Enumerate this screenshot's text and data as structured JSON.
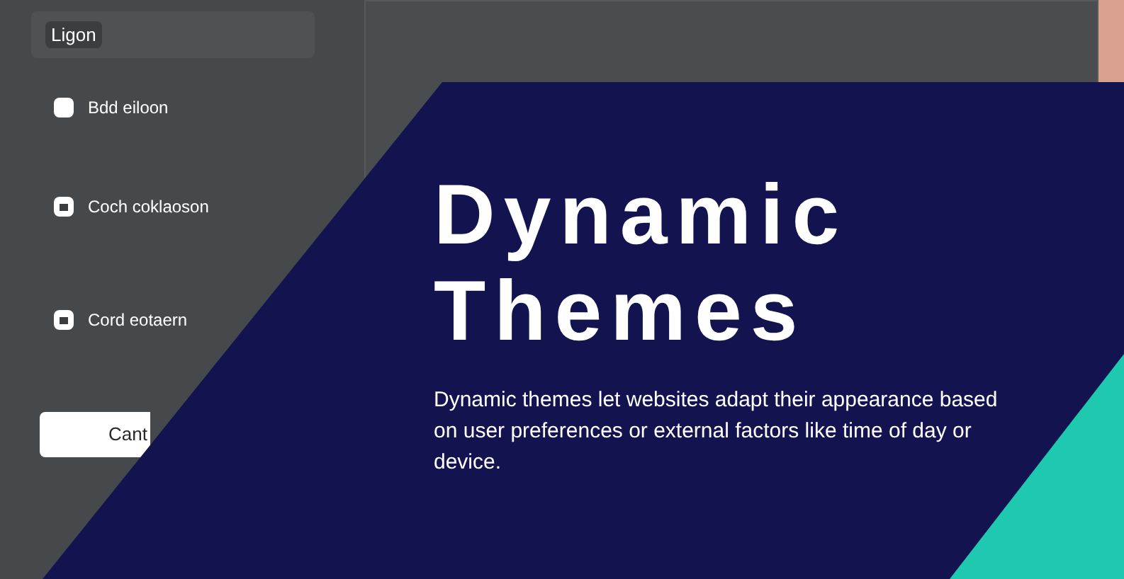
{
  "left_panel": {
    "title": "Ligon",
    "options": [
      {
        "label": "Bdd eiloon",
        "checked": false
      },
      {
        "label": "Coch coklaoson",
        "checked": true
      },
      {
        "label": "Cord eotaern",
        "checked": true
      }
    ],
    "button": "Cant"
  },
  "hero": {
    "title_lines": [
      "Dynamic",
      "Themes"
    ],
    "description": "Dynamic themes let websites adapt their appearance based on user preferences or external factors like time of day or device."
  }
}
